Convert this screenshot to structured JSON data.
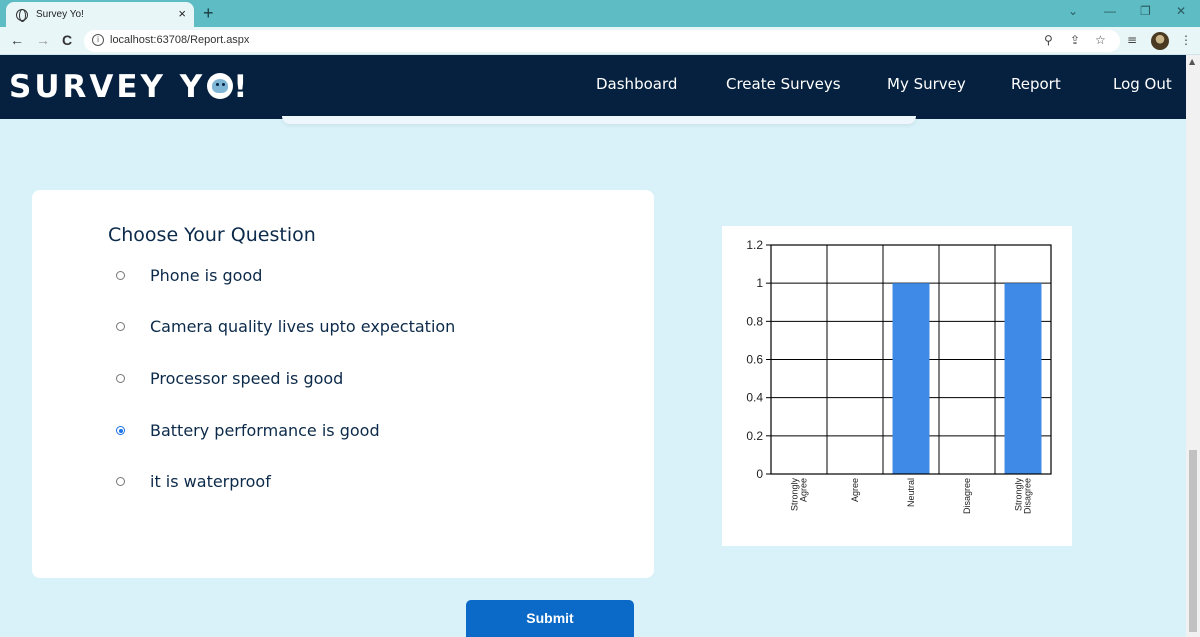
{
  "browser": {
    "tab_title": "Survey Yo!",
    "tab_close": "×",
    "new_tab": "+",
    "url": "localhost:63708/Report.aspx",
    "back_icon": "←",
    "forward_icon": "→",
    "reload_icon": "C",
    "info_icon": "i",
    "zoom_icon": "⚲",
    "share_icon": "⇪",
    "star_icon": "☆",
    "playlist_icon": "≡",
    "menu_icon": "⋮",
    "minimize": "—",
    "restore": "❐",
    "close": "✕",
    "chevron": "⌄"
  },
  "header": {
    "logo_text": "SURVEY Y",
    "logo_suffix": "!",
    "nav": [
      "Dashboard",
      "Create Surveys",
      "My Survey",
      "Report",
      "Log Out"
    ]
  },
  "question_card": {
    "title": "Choose Your Question",
    "options": [
      {
        "label": "Phone is good",
        "selected": false
      },
      {
        "label": "Camera quality lives upto expectation",
        "selected": false
      },
      {
        "label": "Processor speed is good",
        "selected": false
      },
      {
        "label": "Battery performance is good",
        "selected": true
      },
      {
        "label": "it is waterproof",
        "selected": false
      }
    ]
  },
  "submit_label": "Submit",
  "colors": {
    "page_bg": "#d9f1f9",
    "header_bg": "#06213f",
    "bar": "#3f8ae6",
    "button": "#0b69c7"
  },
  "chart_data": {
    "type": "bar",
    "categories": [
      "Strongly Agree",
      "Agree",
      "Neutral",
      "Disagree",
      "Strongly Disagree"
    ],
    "values": [
      0,
      0,
      1,
      0,
      1
    ],
    "yticks": [
      "0",
      "0.2",
      "0.4",
      "0.6",
      "0.8",
      "1",
      "1.2"
    ],
    "ylim": [
      0,
      1.2
    ],
    "grid": true,
    "title": "",
    "xlabel": "",
    "ylabel": ""
  }
}
